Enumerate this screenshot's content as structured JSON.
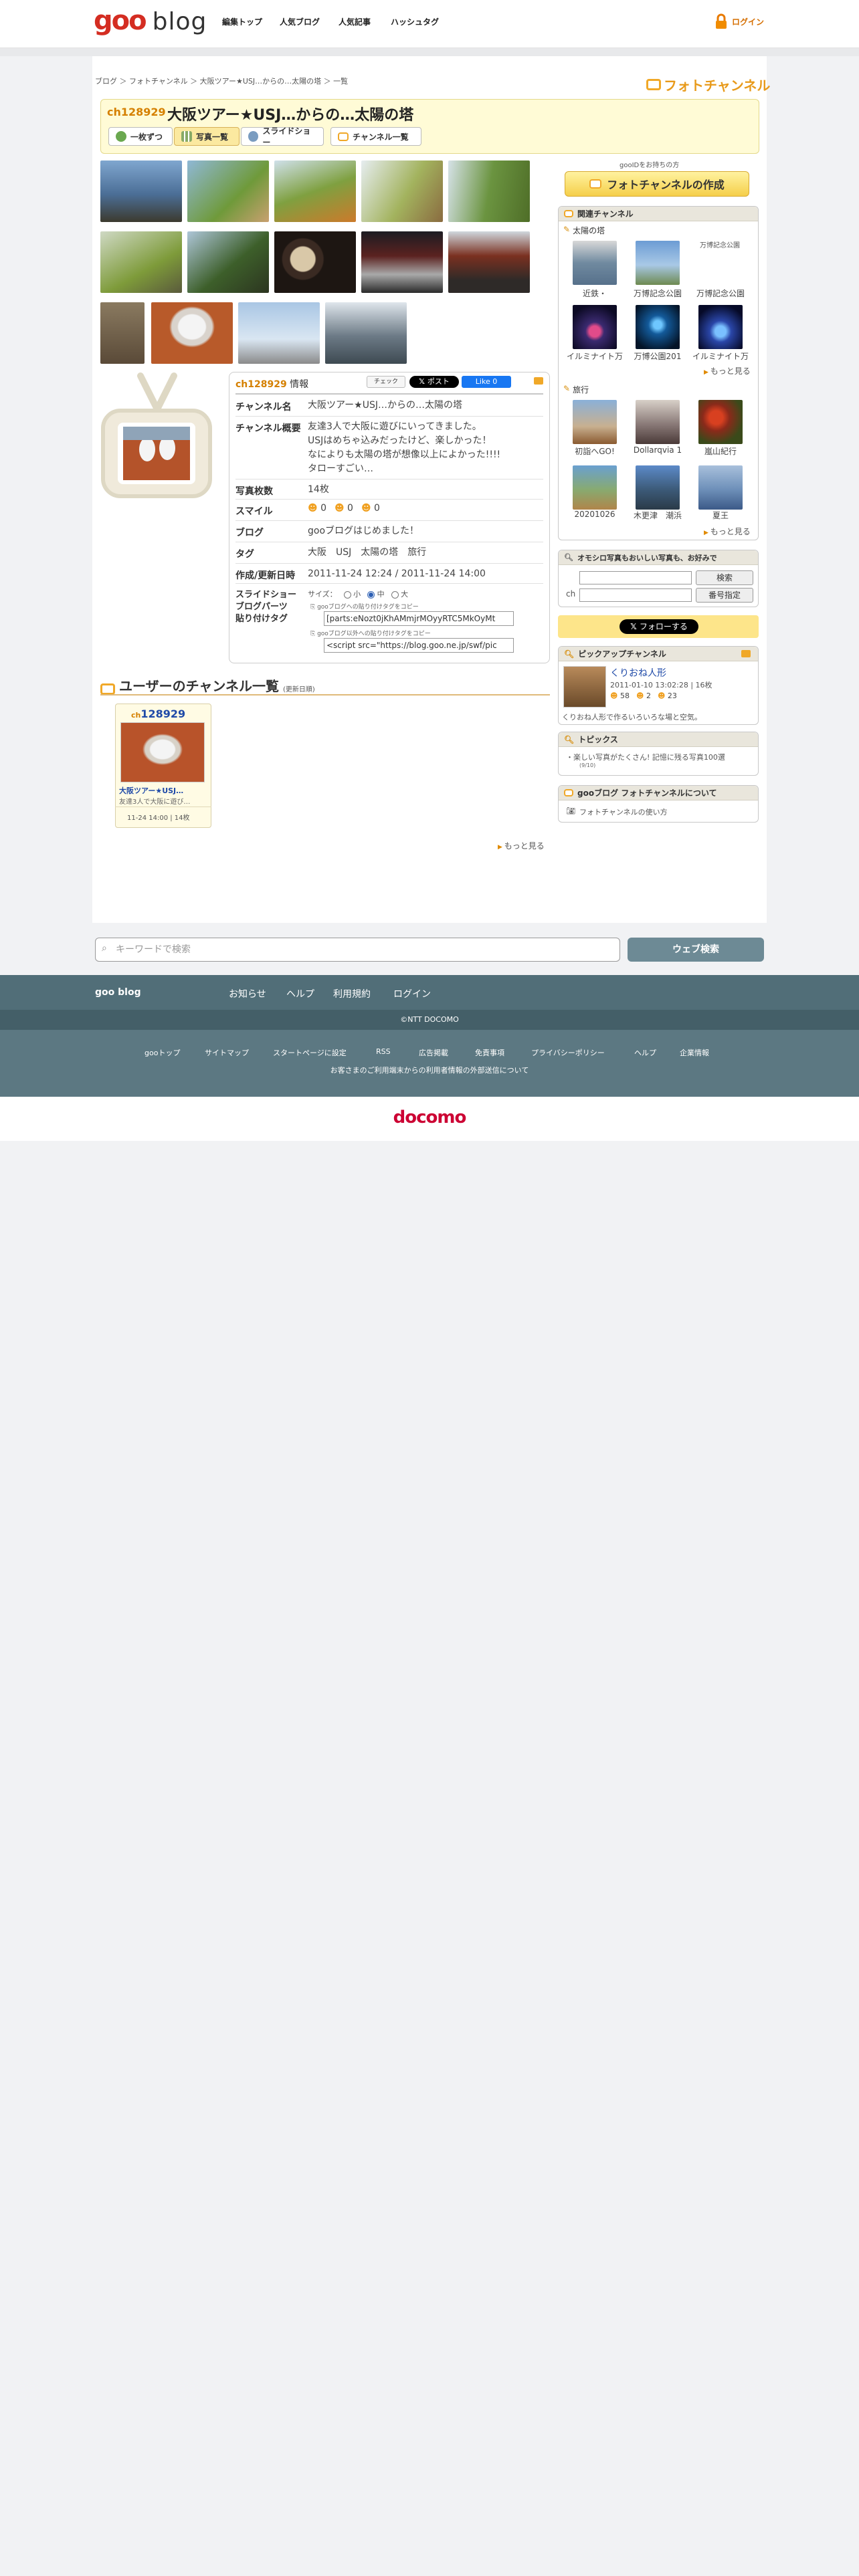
{
  "header": {
    "logo_goo": "goo",
    "logo_blog": "blog",
    "nav": [
      "編集トップ",
      "人気ブログ",
      "人気記事",
      "ハッシュタグ"
    ],
    "login": "ログイン"
  },
  "breadcrumb": [
    "ブログ",
    "フォトチャンネル",
    "大阪ツアー★USJ…からの…太陽の塔",
    "一覧"
  ],
  "photo_channel_logo": "フォトチャンネル",
  "channel": {
    "id": "ch128929",
    "title": "大阪ツアー★USJ…からの…太陽の塔",
    "tabs": [
      "一枚ずつ",
      "写真一覧",
      "スライドショー",
      "チャンネル一覧"
    ]
  },
  "info": {
    "heading_id": "ch128929",
    "heading_suffix": "情報",
    "check_label": "チェック",
    "post_label": "ポスト",
    "like_label": "Like 0",
    "rows": {
      "name_label": "チャンネル名",
      "name_value": "大阪ツアー★USJ…からの…太陽の塔",
      "summary_label": "チャンネル概要",
      "summary_lines": [
        "友達3人で大阪に遊びにいってきました。",
        "USJはめちゃ込みだったけど、楽しかった！",
        "なによりも太陽の塔が想像以上によかった!!!!",
        "タローすごい…"
      ],
      "count_label": "写真枚数",
      "count_value": "14枚",
      "smile_label": "スマイル",
      "smile_values": [
        "0",
        "0",
        "0"
      ],
      "blog_label": "ブログ",
      "blog_value": "gooブログはじめました！",
      "tag_label": "タグ",
      "tags": [
        "大阪",
        "USJ",
        "太陽の塔",
        "旅行"
      ],
      "date_label": "作成/更新日時",
      "date_value": "2011-11-24 12:24 / 2011-11-24 14:00",
      "slide_label_1": "スライドショー",
      "slide_label_2": "ブログパーツ",
      "slide_label_3": "貼り付けタグ",
      "size_label": "サイズ：",
      "sizes": [
        "小",
        "中",
        "大"
      ],
      "copy1_label": "gooブログへの貼り付けタグをコピー",
      "copy1_value": "[parts:eNozt0jKhAMmjrMOyyRTC5MkOyMt",
      "copy2_label": "gooブログ以外への貼り付けタグをコピー",
      "copy2_value": "<script src=\"https://blog.goo.ne.jp/swf/pic"
    }
  },
  "user_channels": {
    "title": "ユーザーのチャンネル一覧",
    "sub": "(更新日順)",
    "card": {
      "id_prefix": "ch",
      "id_num": "128929",
      "title": "大阪ツアー★USJ…",
      "desc": "友達3人で大阪に遊び…",
      "meta": "11-24 14:00 | 14枚"
    },
    "more": "もっと見る"
  },
  "sidebar": {
    "create_note": "gooIDをお持ちの方",
    "create_btn": "フォトチャンネルの作成",
    "related": {
      "title": "関連チャンネル",
      "group1": "太陽の塔",
      "g1_items": [
        "近鉄・",
        "万博記念公園",
        "万博記念公園",
        "イルミナイト万",
        "万博公園201",
        "イルミナイト万"
      ],
      "g1_alt": "万博記念公園",
      "group2": "旅行",
      "g2_items": [
        "初詣へGO!",
        "Dollarqvia 1",
        "嵐山紀行",
        "20201026",
        "木更津　潮浜",
        "夏王"
      ],
      "more": "もっと見る"
    },
    "search": {
      "title": "オモシロ写真もおいしい写真も、お好みで",
      "btn1": "検索",
      "prefix": "ch",
      "btn2": "番号指定"
    },
    "follow": "フォローする",
    "pickup": {
      "title": "ピックアップチャンネル",
      "name": "くりおね人形",
      "meta": "2011-01-10 13:02:28 | 16枚",
      "smiles": [
        "58",
        "2",
        "23"
      ],
      "desc": "くりおね人形で作るいろいろな場と空気。"
    },
    "topics": {
      "title": "トピックス",
      "item": "楽しい写真がたくさん! 記憶に残る写真100選",
      "item_date": "(9/10)"
    },
    "about": {
      "title": "gooブログ フォトチャンネルについて",
      "link": "フォトチャンネルの使い方"
    }
  },
  "footer": {
    "search_placeholder": "キーワードで検索",
    "search_btn": "ウェブ検索",
    "brand": "goo blog",
    "links1": [
      "お知らせ",
      "ヘルプ",
      "利用規約",
      "ログイン"
    ],
    "copyright": "©NTT DOCOMO",
    "links2": [
      "gooトップ",
      "サイトマップ",
      "スタートページに設定",
      "RSS",
      "広告掲載",
      "免責事項",
      "プライバシーポリシー",
      "ヘルプ",
      "企業情報"
    ],
    "notice": "お客さまのご利用端末からの利用者情報の外部送信について",
    "docomo": "docomo"
  },
  "colors": {
    "accent": "#f0a828",
    "footer_dark": "#516e78",
    "docomo_red": "#cc0033"
  }
}
